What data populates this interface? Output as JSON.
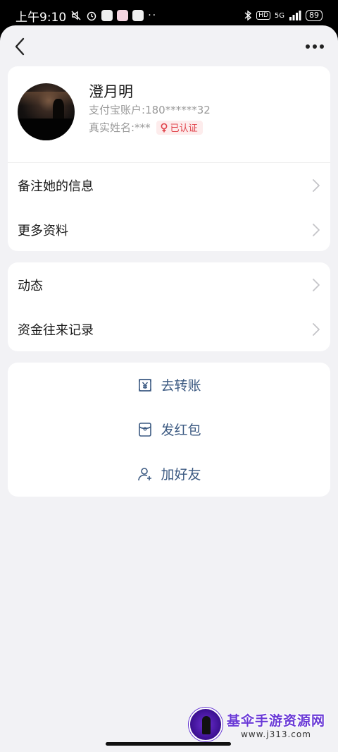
{
  "status_bar": {
    "time": "上午9:10",
    "network": "5G",
    "hd_label": "HD",
    "battery": "89"
  },
  "profile": {
    "name": "澄月明",
    "account_label": "支付宝账户:",
    "account_value": "180******32",
    "realname_label": "真实姓名:",
    "realname_value": "***",
    "verified_label": "已认证"
  },
  "info_menu": [
    {
      "label": "备注她的信息"
    },
    {
      "label": "更多资料"
    }
  ],
  "social_menu": [
    {
      "label": "动态"
    },
    {
      "label": "资金往来记录"
    }
  ],
  "actions": [
    {
      "label": "去转账",
      "icon": "transfer-yuan-icon"
    },
    {
      "label": "发红包",
      "icon": "red-envelope-icon"
    },
    {
      "label": "加好友",
      "icon": "add-friend-icon"
    }
  ],
  "watermark": {
    "title": "基伞手游资源网",
    "url": "www.j313.com"
  },
  "colors": {
    "page_bg": "#f2f2f5",
    "card_bg": "#ffffff",
    "action_blue": "#3c5a82",
    "verified_red": "#e0424a",
    "muted_text": "#999999"
  }
}
